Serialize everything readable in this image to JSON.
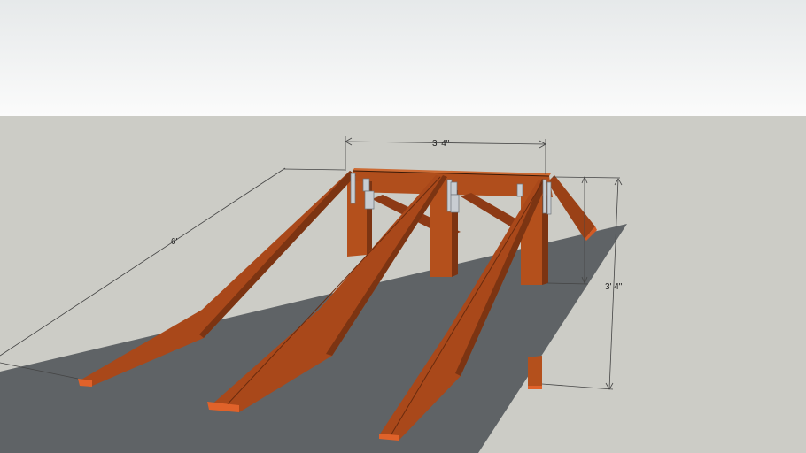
{
  "scene": {
    "sky_top_color": "#e6e9ea",
    "sky_bottom_color": "#fbfbfb",
    "ground_color": "#ccccc6",
    "plane_color": "#5f6366",
    "wood_light": "#b4501c",
    "wood_dark": "#7c3412",
    "wood_end": "#e0622a",
    "bracket_color": "#c8cdd2"
  },
  "dimensions": {
    "top_width": "3' 4\"",
    "length": "6'",
    "height": "3' 4\""
  }
}
